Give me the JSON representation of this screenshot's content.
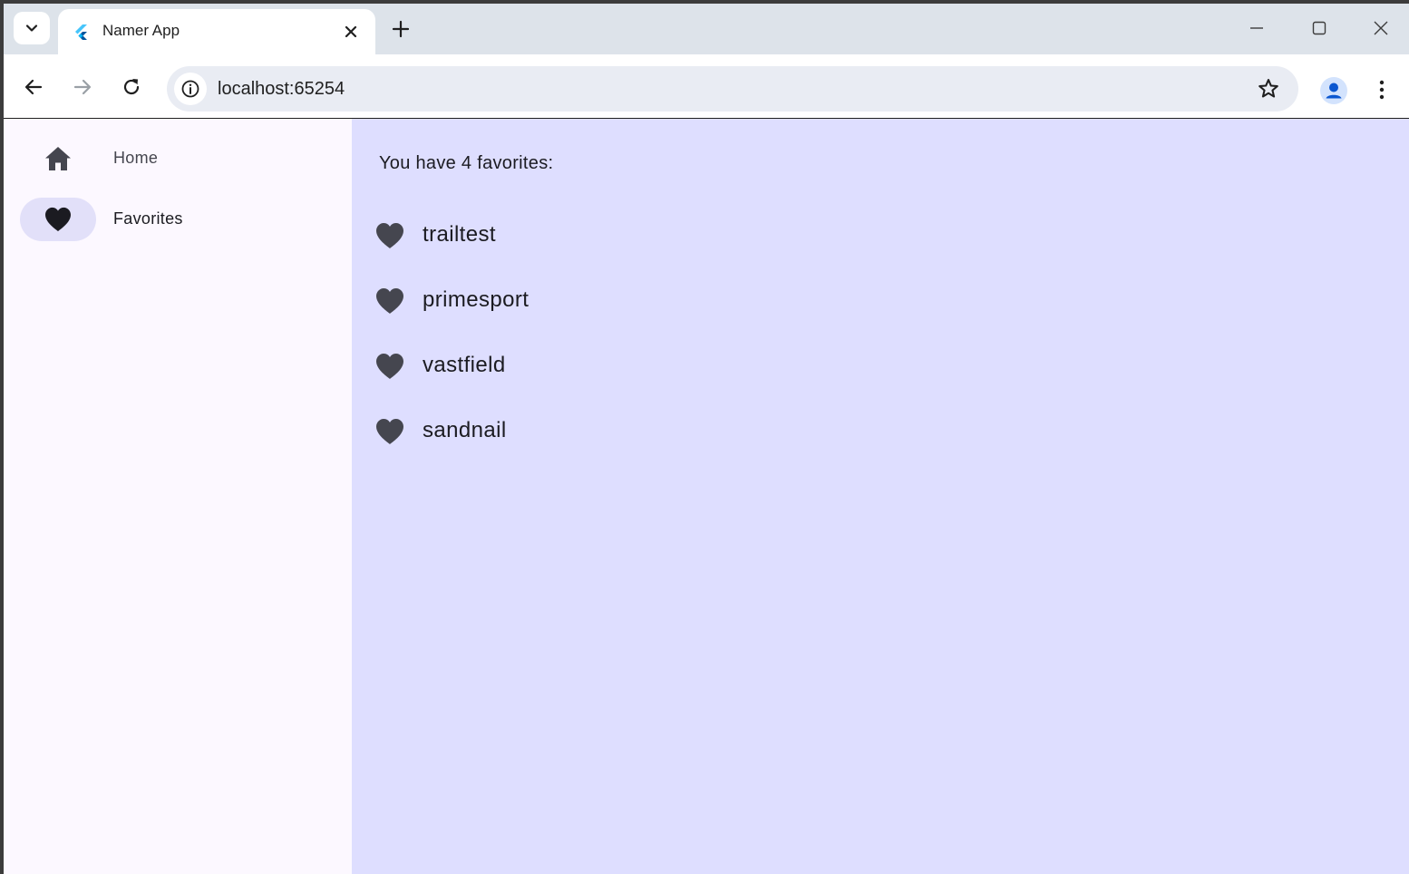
{
  "browser": {
    "tab_title": "Namer App",
    "url": "localhost:65254"
  },
  "nav": {
    "items": [
      {
        "label": "Home",
        "icon": "home-icon",
        "selected": false
      },
      {
        "label": "Favorites",
        "icon": "heart-icon",
        "selected": true
      }
    ]
  },
  "favorites": {
    "header": "You have 4 favorites:",
    "items": [
      "trailtest",
      "primesport",
      "vastfield",
      "sandnail"
    ]
  },
  "colors": {
    "main_bg": "#dedeff",
    "rail_bg": "#fcf8ff",
    "indicator": "#e2e0f9",
    "icon": "#45464f",
    "chrome_tabstrip": "#dde3ea"
  }
}
